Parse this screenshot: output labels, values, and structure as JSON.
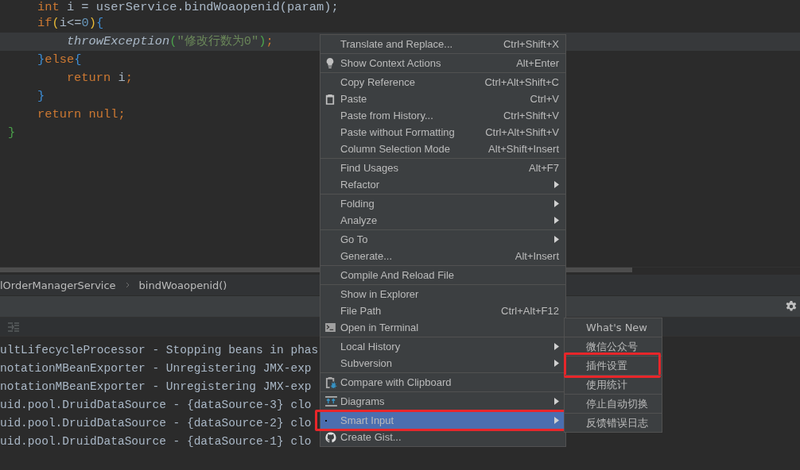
{
  "editor": {
    "lines": [
      {
        "current": false,
        "tokens": [
          {
            "kind": "keyword",
            "text": "    int "
          },
          {
            "kind": "plain",
            "text": "i = userService.bindWoaopenid(param);"
          }
        ]
      },
      {
        "current": false,
        "tokens": [
          {
            "kind": "keyword",
            "text": "    if"
          },
          {
            "kind": "paren",
            "text": "("
          },
          {
            "kind": "plain",
            "text": "i<="
          },
          {
            "kind": "number",
            "text": "0"
          },
          {
            "kind": "paren",
            "text": ")"
          },
          {
            "kind": "brace",
            "text": "{"
          }
        ]
      },
      {
        "current": true,
        "tokens": [
          {
            "kind": "method",
            "text": "        throwException"
          },
          {
            "kind": "green",
            "text": "("
          },
          {
            "kind": "string",
            "text": "\"修改行数为0\""
          },
          {
            "kind": "green",
            "text": ")"
          },
          {
            "kind": "keyword",
            "text": ";"
          }
        ]
      },
      {
        "current": false,
        "tokens": [
          {
            "kind": "brace",
            "text": "    }"
          },
          {
            "kind": "keyword",
            "text": "else"
          },
          {
            "kind": "brace",
            "text": "{"
          }
        ]
      },
      {
        "current": false,
        "tokens": [
          {
            "kind": "keyword",
            "text": "        return "
          },
          {
            "kind": "plain",
            "text": "i"
          },
          {
            "kind": "keyword",
            "text": ";"
          }
        ]
      },
      {
        "current": false,
        "tokens": [
          {
            "kind": "brace",
            "text": "    }"
          }
        ]
      },
      {
        "current": false,
        "tokens": [
          {
            "kind": "keyword",
            "text": "    return null;"
          }
        ]
      },
      {
        "current": false,
        "tokens": [
          {
            "kind": "green",
            "text": "}"
          }
        ]
      }
    ]
  },
  "breadcrumbs": [
    "lOrderManagerService",
    "bindWoaopenid()"
  ],
  "console": {
    "lines": [
      "ultLifecycleProcessor - Stopping beans in phas",
      "notationMBeanExporter - Unregistering JMX-exp",
      "notationMBeanExporter - Unregistering JMX-exp",
      "uid.pool.DruidDataSource - {dataSource-3} clo",
      "uid.pool.DruidDataSource - {dataSource-2} clo",
      "uid.pool.DruidDataSource - {dataSource-1} clo"
    ]
  },
  "context_menu": {
    "groups": [
      [
        {
          "label": "Translate and Replace...",
          "shortcut": "Ctrl+Shift+X",
          "submenu": false,
          "selected": false,
          "outlined": false
        }
      ],
      [
        {
          "label": "Show Context Actions",
          "shortcut": "Alt+Enter",
          "submenu": false,
          "selected": false,
          "outlined": false
        }
      ],
      [
        {
          "label": "Copy Reference",
          "shortcut": "Ctrl+Alt+Shift+C",
          "submenu": false,
          "selected": false,
          "outlined": false
        },
        {
          "label": "Paste",
          "shortcut": "Ctrl+V",
          "submenu": false,
          "selected": false,
          "outlined": false
        },
        {
          "label": "Paste from History...",
          "shortcut": "Ctrl+Shift+V",
          "submenu": false,
          "selected": false,
          "outlined": false
        },
        {
          "label": "Paste without Formatting",
          "shortcut": "Ctrl+Alt+Shift+V",
          "submenu": false,
          "selected": false,
          "outlined": false
        },
        {
          "label": "Column Selection Mode",
          "shortcut": "Alt+Shift+Insert",
          "submenu": false,
          "selected": false,
          "outlined": false
        }
      ],
      [
        {
          "label": "Find Usages",
          "shortcut": "Alt+F7",
          "submenu": false,
          "selected": false,
          "outlined": false
        },
        {
          "label": "Refactor",
          "submenu": true,
          "selected": false,
          "outlined": false
        }
      ],
      [
        {
          "label": "Folding",
          "submenu": true,
          "selected": false,
          "outlined": false
        },
        {
          "label": "Analyze",
          "submenu": true,
          "selected": false,
          "outlined": false
        }
      ],
      [
        {
          "label": "Go To",
          "submenu": true,
          "selected": false,
          "outlined": false
        },
        {
          "label": "Generate...",
          "shortcut": "Alt+Insert",
          "submenu": false,
          "selected": false,
          "outlined": false
        }
      ],
      [
        {
          "label": "Compile And Reload File",
          "submenu": false,
          "selected": false,
          "outlined": false
        }
      ],
      [
        {
          "label": "Show in Explorer",
          "submenu": false,
          "selected": false,
          "outlined": false
        },
        {
          "label": "File Path",
          "shortcut": "Ctrl+Alt+F12",
          "submenu": false,
          "selected": false,
          "outlined": false
        },
        {
          "label": "Open in Terminal",
          "submenu": false,
          "selected": false,
          "outlined": false
        }
      ],
      [
        {
          "label": "Local History",
          "submenu": true,
          "selected": false,
          "outlined": false
        },
        {
          "label": "Subversion",
          "submenu": true,
          "selected": false,
          "outlined": false
        }
      ],
      [
        {
          "label": "Compare with Clipboard",
          "submenu": false,
          "selected": false,
          "outlined": false
        }
      ],
      [
        {
          "label": "Diagrams",
          "submenu": true,
          "selected": false,
          "outlined": false
        }
      ],
      [
        {
          "label": "Smart Input",
          "submenu": true,
          "selected": true,
          "outlined": true
        },
        {
          "label": "Create Gist...",
          "submenu": false,
          "selected": false,
          "outlined": false
        }
      ]
    ]
  },
  "submenu": {
    "items": [
      {
        "label": "What's New",
        "selected": false,
        "outlined": false
      },
      {
        "label": "微信公众号",
        "selected": false,
        "outlined": false
      },
      {
        "label": "插件设置",
        "selected": false,
        "outlined": true
      },
      {
        "label": "使用统计",
        "selected": false,
        "outlined": false
      },
      {
        "label": "停止自动切换",
        "selected": false,
        "outlined": false
      },
      {
        "label": "反馈错误日志",
        "selected": false,
        "outlined": false
      }
    ]
  }
}
